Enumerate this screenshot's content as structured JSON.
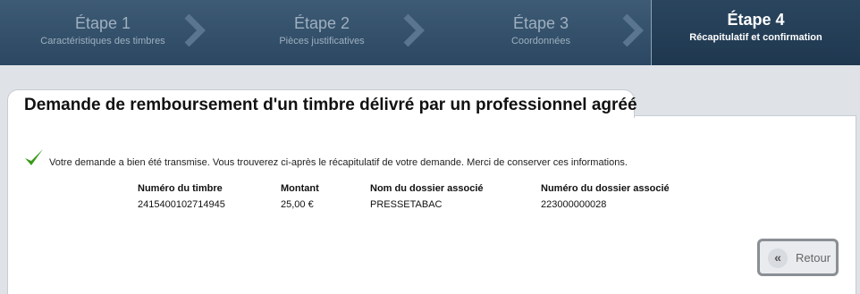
{
  "steps": [
    {
      "title": "Étape 1",
      "subtitle": "Caractéristiques des timbres",
      "active": false
    },
    {
      "title": "Étape 2",
      "subtitle": "Pièces justificatives",
      "active": false
    },
    {
      "title": "Étape 3",
      "subtitle": "Coordonnées",
      "active": false
    },
    {
      "title": "Étape 4",
      "subtitle": "Récapitulatif et confirmation",
      "active": true
    }
  ],
  "page": {
    "title": "Demande de remboursement d'un timbre délivré par un professionnel agréé"
  },
  "confirmation": {
    "icon": "check-icon",
    "message": "Votre demande a bien été transmise. Vous trouverez ci-après le récapitulatif de votre demande. Merci de conserver ces informations."
  },
  "summary": {
    "headers": [
      "Numéro du timbre",
      "Montant",
      "Nom du dossier associé",
      "Numéro du dossier associé"
    ],
    "row": [
      "2415400102714945",
      "25,00 €",
      "PRESSETABAC",
      "223000000028"
    ]
  },
  "actions": {
    "back_icon": "«",
    "back_label": "Retour"
  },
  "colors": {
    "accent_check": "#3a9a1b",
    "stepbar": "#2f4d68",
    "active_step": "#233d55"
  }
}
